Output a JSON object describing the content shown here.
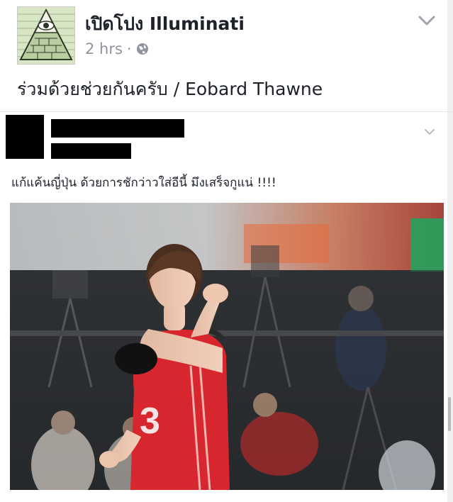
{
  "post": {
    "page_name": "เปิดโปง Illuminati",
    "time": "2 hrs",
    "separator": "·",
    "text": "ร่วมด้วยช่วยกันครับ / Eobard Thawne"
  },
  "shared": {
    "caption": "แก้แค้นญี่ปุ่น ด้วยการชักว่าวใส่อีนี้ มึงเสร็จกูแน่ !!!!"
  },
  "photo": {
    "jersey_number": "3"
  },
  "colors": {
    "muted": "#90949c",
    "text": "#1d2129",
    "jersey": "#d7262e"
  },
  "icons": {
    "privacy": "globe-icon",
    "options": "chevron-down-icon",
    "avatar": "eye-pyramid-icon"
  }
}
